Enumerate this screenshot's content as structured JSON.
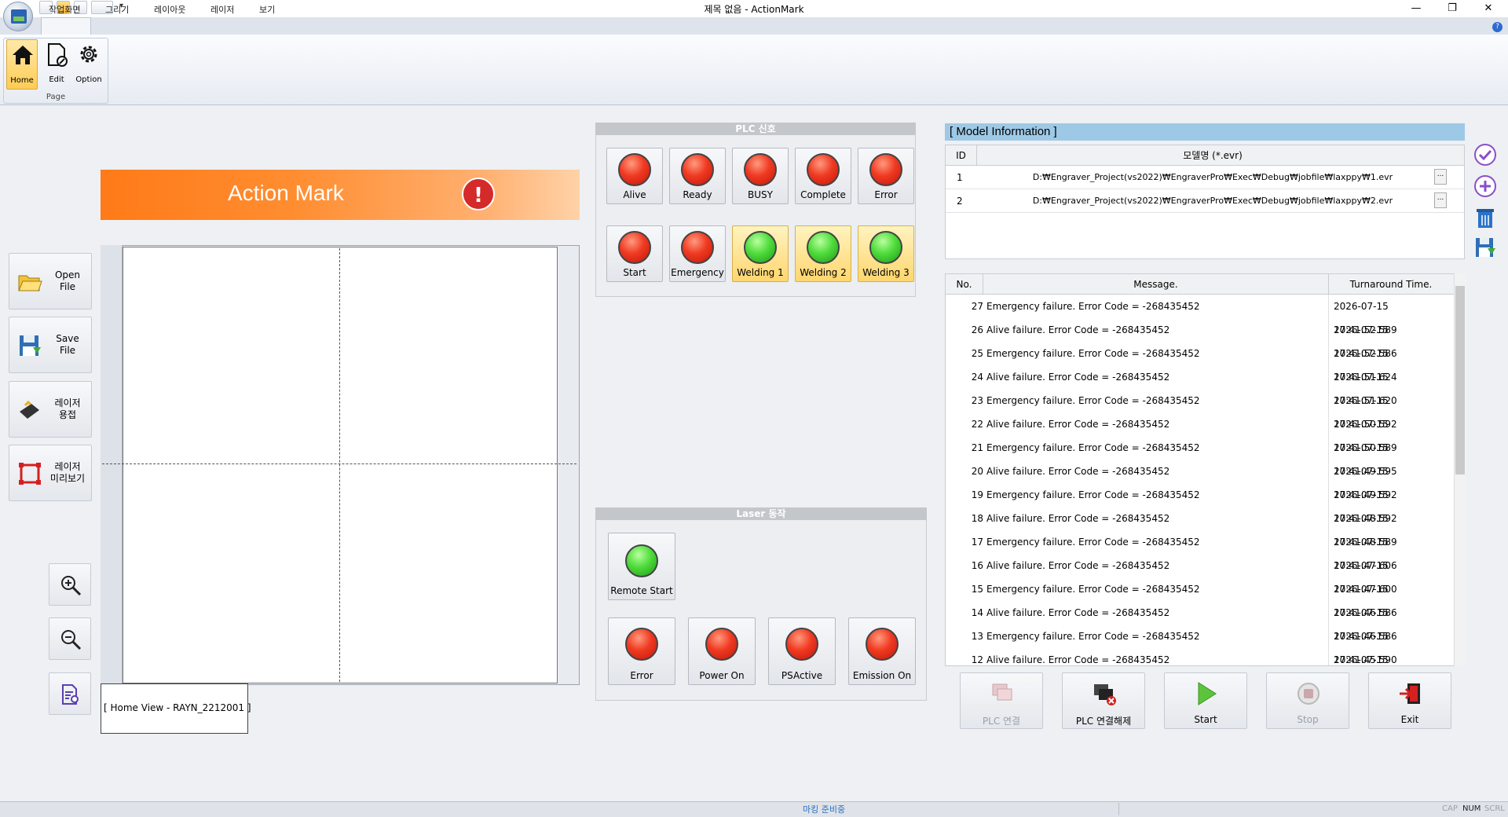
{
  "window": {
    "title": "제목 없음 - ActionMark",
    "minimize": "—",
    "restore": "❐",
    "close": "✕"
  },
  "qat": {
    "more": "▾"
  },
  "menu": {
    "items": [
      "작업화면",
      "그리기",
      "레이아웃",
      "레이저",
      "보기"
    ],
    "help": "?"
  },
  "ribbon": {
    "group_label": "Page",
    "buttons": {
      "home": "Home",
      "edit": "Edit",
      "option": "Option"
    }
  },
  "banner": {
    "title": "Action Mark",
    "alert": "!"
  },
  "tools": {
    "open_file": "Open\nFile",
    "save_file": "Save\nFile",
    "laser_weld": "레이저\n용접",
    "laser_preview": "레이저\n미리보기"
  },
  "canvas": {
    "view_label": "[ Home View - RAYN_2212001 ]"
  },
  "plc": {
    "title": "PLC 신호",
    "signals": [
      {
        "label": "Alive",
        "state": "red"
      },
      {
        "label": "Ready",
        "state": "red"
      },
      {
        "label": "BUSY",
        "state": "red"
      },
      {
        "label": "Complete",
        "state": "red"
      },
      {
        "label": "Error",
        "state": "red"
      },
      {
        "label": "Start",
        "state": "red"
      },
      {
        "label": "Emergency",
        "state": "red"
      },
      {
        "label": "Welding 1",
        "state": "green"
      },
      {
        "label": "Welding 2",
        "state": "green"
      },
      {
        "label": "Welding 3",
        "state": "green"
      }
    ]
  },
  "laser": {
    "title": "Laser 동작",
    "remote_start": {
      "label": "Remote Start",
      "state": "green"
    },
    "signals": [
      {
        "label": "Error",
        "state": "red"
      },
      {
        "label": "Power On",
        "state": "red"
      },
      {
        "label": "PSActive",
        "state": "red"
      },
      {
        "label": "Emission On",
        "state": "red"
      }
    ]
  },
  "model_info": {
    "title": "[ Model Information ]",
    "col_id": "ID",
    "col_name": "모델명 (*.evr)",
    "rows": [
      {
        "id": "1",
        "path": "D:₩Engraver_Project(vs2022)₩EngraverPro₩Exec₩Debug₩jobfile₩laxppy₩1.evr"
      },
      {
        "id": "2",
        "path": "D:₩Engraver_Project(vs2022)₩EngraverPro₩Exec₩Debug₩jobfile₩laxppy₩2.evr"
      }
    ],
    "dots": "..."
  },
  "log": {
    "col_no": "No.",
    "col_msg": "Message.",
    "col_time": "Turnaround Time.",
    "rows": [
      {
        "no": "27",
        "msg": "Emergency failure. Error Code = -268435452",
        "time": "2026-07-15 17:41:52.589"
      },
      {
        "no": "26",
        "msg": "Alive failure. Error Code = -268435452",
        "time": "2026-07-15 17:41:52.586"
      },
      {
        "no": "25",
        "msg": "Emergency failure. Error Code = -268435452",
        "time": "2026-07-15 17:41:51.624"
      },
      {
        "no": "24",
        "msg": "Alive failure. Error Code = -268435452",
        "time": "2026-07-15 17:41:51.620"
      },
      {
        "no": "23",
        "msg": "Emergency failure. Error Code = -268435452",
        "time": "2026-07-15 17:41:50.592"
      },
      {
        "no": "22",
        "msg": "Alive failure. Error Code = -268435452",
        "time": "2026-07-15 17:41:50.589"
      },
      {
        "no": "21",
        "msg": "Emergency failure. Error Code = -268435452",
        "time": "2026-07-15 17:41:49.595"
      },
      {
        "no": "20",
        "msg": "Alive failure. Error Code = -268435452",
        "time": "2026-07-15 17:41:49.592"
      },
      {
        "no": "19",
        "msg": "Emergency failure. Error Code = -268435452",
        "time": "2026-07-15 17:41:48.592"
      },
      {
        "no": "18",
        "msg": "Alive failure. Error Code = -268435452",
        "time": "2026-07-15 17:41:48.589"
      },
      {
        "no": "17",
        "msg": "Emergency failure. Error Code = -268435452",
        "time": "2026-07-15 17:41:47.606"
      },
      {
        "no": "16",
        "msg": "Alive failure. Error Code = -268435452",
        "time": "2026-07-15 17:41:47.600"
      },
      {
        "no": "15",
        "msg": "Emergency failure. Error Code = -268435452",
        "time": "2026-07-15 17:41:46.586"
      },
      {
        "no": "14",
        "msg": "Alive failure. Error Code = -268435452",
        "time": "2026-07-15 17:41:46.586"
      },
      {
        "no": "13",
        "msg": "Emergency failure. Error Code = -268435452",
        "time": "2026-07-15 17:41:45.590"
      },
      {
        "no": "12",
        "msg": "Alive failure. Error Code = -268435452",
        "time": "2026-07-15 17:41:45.589"
      }
    ]
  },
  "actions": {
    "plc_connect": "PLC 연결",
    "plc_disconnect": "PLC 연결해제",
    "start": "Start",
    "stop": "Stop",
    "exit": "Exit"
  },
  "status": {
    "text": "마킹 준비중",
    "cap": "CAP",
    "num": "NUM",
    "scrl": "SCRL"
  },
  "colors": {
    "accent": "#ff7a18",
    "lamp_red": "#f03a22",
    "lamp_green": "#4fdc3c",
    "model_header": "#9ec9e6"
  }
}
